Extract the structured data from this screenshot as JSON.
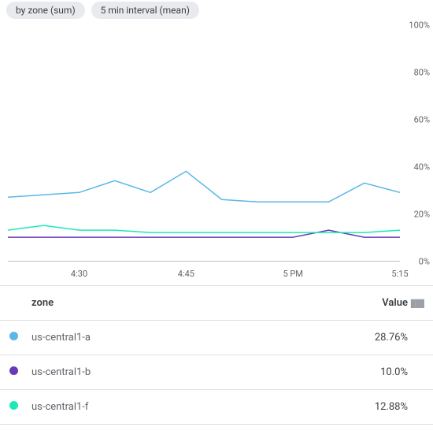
{
  "chips": [
    "by zone (sum)",
    "5 min interval (mean)"
  ],
  "chart_data": {
    "type": "line",
    "ylim": [
      0,
      100
    ],
    "yunit": "%",
    "yticks": [
      0,
      20,
      40,
      60,
      80,
      100
    ],
    "x": [
      "4:20",
      "4:25",
      "4:30",
      "4:35",
      "4:40",
      "4:45",
      "4:50",
      "4:55",
      "5:00",
      "5:05",
      "5:10",
      "5:15"
    ],
    "xticks": [
      {
        "label": "4:30",
        "at": "4:30"
      },
      {
        "label": "4:45",
        "at": "4:45"
      },
      {
        "label": "5 PM",
        "at": "5:00"
      },
      {
        "label": "5:15",
        "at": "5:15"
      }
    ],
    "series": [
      {
        "name": "us-central1-a",
        "color": "#5ab7e8",
        "values": [
          27,
          28,
          29,
          29,
          34,
          29,
          38,
          27,
          26,
          25,
          25,
          25,
          30,
          33,
          29
        ]
      },
      {
        "name": "us-central1-b",
        "color": "#673ab7",
        "values": [
          10,
          10,
          10,
          10,
          10,
          10,
          10,
          10,
          10,
          10,
          10,
          13,
          11,
          10,
          10
        ]
      },
      {
        "name": "us-central1-f",
        "color": "#1de9b6",
        "values": [
          13,
          15,
          13,
          13,
          13,
          12,
          12,
          13,
          12,
          12,
          12,
          12,
          13,
          12,
          13
        ]
      }
    ]
  },
  "legend": {
    "header_name": "zone",
    "header_value": "Value",
    "rows": [
      {
        "color": "#5ab7e8",
        "name": "us-central1-a",
        "value": "28.76%"
      },
      {
        "color": "#673ab7",
        "name": "us-central1-b",
        "value": "10.0%"
      },
      {
        "color": "#1de9b6",
        "name": "us-central1-f",
        "value": "12.88%"
      }
    ]
  }
}
